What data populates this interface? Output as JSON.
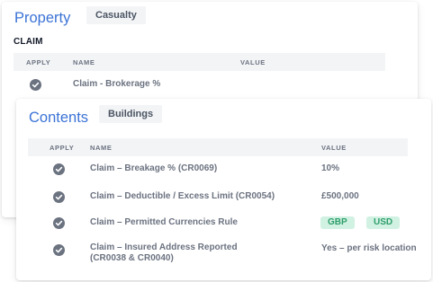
{
  "property_panel": {
    "title": "Property",
    "tab": "Casualty",
    "section": "CLAIM",
    "columns": {
      "apply": "APPLY",
      "name": "NAME",
      "value": "VALUE"
    },
    "rows": [
      {
        "name": "Claim - Brokerage %",
        "applied": true
      }
    ]
  },
  "contents_panel": {
    "title": "Contents",
    "tab": "Buildings",
    "columns": {
      "apply": "APPLY",
      "name": "NAME",
      "value": "VALUE"
    },
    "rows": [
      {
        "name": "Claim – Breakage % (CR0069)",
        "value": "10%",
        "applied": true
      },
      {
        "name": "Claim – Deductible / Excess Limit (CR0054)",
        "value": "£500,000",
        "applied": true
      },
      {
        "name": "Claim – Permitted Currencies Rule",
        "tags": [
          "GBP",
          "USD"
        ],
        "applied": true
      },
      {
        "name_line1": "Claim – Insured Address Reported",
        "name_line2": "(CR0038 & CR0040)",
        "value": "Yes – per risk location",
        "applied": true
      }
    ]
  },
  "colors": {
    "accent": "#3b73d6",
    "tag_bg": "#d1f1e3",
    "tag_text": "#2f9e6a",
    "check": "#6b7280"
  },
  "icons": {
    "apply": "check-circle-icon"
  }
}
